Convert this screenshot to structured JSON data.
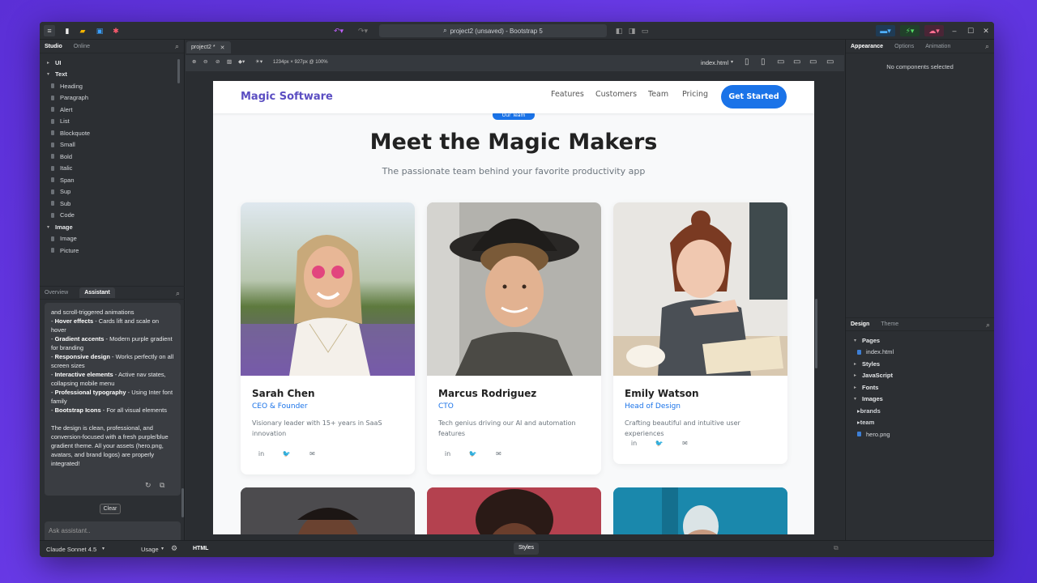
{
  "window": {
    "title": "project2 (unsaved) - Bootstrap 5"
  },
  "left_panel": {
    "tabs": [
      "Studio",
      "Online"
    ],
    "tree": [
      {
        "label": "UI",
        "type": "cat",
        "open": false
      },
      {
        "label": "Text",
        "type": "cat",
        "open": true
      },
      {
        "label": "Heading",
        "type": "leaf"
      },
      {
        "label": "Paragraph",
        "type": "leaf"
      },
      {
        "label": "Alert",
        "type": "leaf"
      },
      {
        "label": "List",
        "type": "leaf"
      },
      {
        "label": "Blockquote",
        "type": "leaf"
      },
      {
        "label": "Small",
        "type": "leaf"
      },
      {
        "label": "Bold",
        "type": "leaf"
      },
      {
        "label": "Italic",
        "type": "leaf"
      },
      {
        "label": "Span",
        "type": "leaf"
      },
      {
        "label": "Sup",
        "type": "leaf"
      },
      {
        "label": "Sub",
        "type": "leaf"
      },
      {
        "label": "Code",
        "type": "leaf"
      },
      {
        "label": "Image",
        "type": "cat",
        "open": true
      },
      {
        "label": "Image",
        "type": "leaf"
      },
      {
        "label": "Picture",
        "type": "leaf"
      }
    ],
    "assistant_tabs": [
      "Overview",
      "Assistant"
    ],
    "chat_text_top": "and scroll-triggered animations",
    "chat_items": [
      {
        "bold": "Hover effects",
        "text": " - Cards lift and scale on hover"
      },
      {
        "bold": "Gradient accents",
        "text": " - Modern purple gradient for branding"
      },
      {
        "bold": "Responsive design",
        "text": " - Works perfectly on all screen sizes"
      },
      {
        "bold": "Interactive elements",
        "text": " - Active nav states, collapsing mobile menu"
      },
      {
        "bold": "Professional typography",
        "text": " - Using Inter font family"
      },
      {
        "bold": "Bootstrap Icons",
        "text": " - For all visual elements"
      }
    ],
    "chat_summary": "The design is clean, professional, and conversion-focused with a fresh purple/blue gradient theme. All your assets (hero.png, avatars, and brand logos) are properly integrated!",
    "clear_label": "Clear",
    "ask_placeholder": "Ask assistant..",
    "model": "Claude Sonnet 4.5",
    "usage": "Usage"
  },
  "center": {
    "tab_label": "project2 *",
    "dims": "1234px × 927px @ 100%",
    "file_select": "index.html",
    "bottom_tabs": {
      "html": "HTML",
      "styles": "Styles"
    }
  },
  "site": {
    "brand": "Magic Software",
    "nav": [
      "Features",
      "Customers",
      "Team",
      "Pricing"
    ],
    "cta": "Get Started",
    "badge": "Our Team",
    "title": "Meet the Magic Makers",
    "subtitle": "The passionate team behind your favorite productivity app",
    "team": [
      {
        "name": "Sarah Chen",
        "role": "CEO & Founder",
        "desc": "Visionary leader with 15+ years in SaaS innovation"
      },
      {
        "name": "Marcus Rodriguez",
        "role": "CTO",
        "desc": "Tech genius driving our AI and automation features"
      },
      {
        "name": "Emily Watson",
        "role": "Head of Design",
        "desc": "Crafting beautiful and intuitive user experiences"
      }
    ]
  },
  "right_panel": {
    "tabs": [
      "Appearance",
      "Options",
      "Animation"
    ],
    "empty_msg": "No components selected",
    "design_tabs": [
      "Design",
      "Theme"
    ],
    "tree": [
      {
        "label": "Pages",
        "type": "cat",
        "open": true
      },
      {
        "label": "index.html",
        "type": "file"
      },
      {
        "label": "Styles",
        "type": "cat",
        "open": false
      },
      {
        "label": "JavaScript",
        "type": "cat",
        "open": false
      },
      {
        "label": "Fonts",
        "type": "cat",
        "open": false
      },
      {
        "label": "Images",
        "type": "cat",
        "open": true
      },
      {
        "label": "brands",
        "type": "sub"
      },
      {
        "label": "team",
        "type": "sub"
      },
      {
        "label": "hero.png",
        "type": "file"
      }
    ]
  },
  "colors": {
    "accent": "#1a73e8",
    "brand": "#5b4ec2"
  }
}
